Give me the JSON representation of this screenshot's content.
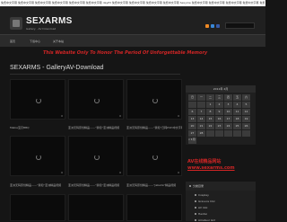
{
  "topbar": {
    "text": "免费中文字幕 免费中文字幕 免费中文字幕 免费中文字幕 免费中文字幕 免费中文字幕 dayP3 免费中文字幕 免费中文字幕 免费中文字幕 免费中文字幕 Sexyme 免费中文字幕 免费中文字幕 免费中文字幕 免费中文字幕 免费中文字幕 免费中文字幕 免费中文字幕"
  },
  "header": {
    "title": "SEXARMS",
    "subtitle": "Gallery · AV Download"
  },
  "nav": {
    "items": [
      "首页",
      "下载中心",
      "关于本站"
    ]
  },
  "marquee": "This Website Only To Honor The Period Of Unforgettable Memory",
  "section_title": "SEXARMS - GalleryAV-Download",
  "posts": [
    {
      "count": "0",
      "caption": "Mabie宝贝BBQ"
    },
    {
      "count": "0",
      "caption": "亚洲无码原创精品——“我和”亚洲精品视频"
    },
    {
      "count": "0",
      "caption": "亚洲无码原创精品——“我和”日韩DVD中文字幕精品"
    },
    {
      "count": "0",
      "caption": "亚洲无码原创精品——“我和”亚洲精品视频"
    },
    {
      "count": "0",
      "caption": "亚洲无码原创精品——“我和”亚洲精品视频"
    },
    {
      "count": "0",
      "caption": "亚洲无码原创精品——“Jabella”精品视频"
    },
    {
      "count": "",
      "caption": ""
    },
    {
      "count": "",
      "caption": ""
    },
    {
      "count": "",
      "caption": ""
    }
  ],
  "calendar": {
    "month": "2011年 2月",
    "weekdays": [
      "日",
      "一",
      "二",
      "三",
      "四",
      "五",
      "六"
    ],
    "days": [
      "",
      "",
      "1",
      "2",
      "3",
      "4",
      "5",
      "6",
      "7",
      "8",
      "9",
      "10",
      "11",
      "12",
      "13",
      "14",
      "15",
      "16",
      "17",
      "18",
      "19",
      "20",
      "21",
      "22",
      "23",
      "24",
      "25",
      "26",
      "27",
      "28",
      "",
      "",
      "",
      "",
      "",
      ""
    ],
    "prev_label": "« 1月"
  },
  "ad": {
    "title": "AV在线精品网站",
    "link": "www.sexarms.com"
  },
  "categories": {
    "title": "分类目录",
    "items": [
      "Cosplay",
      "Gravure Idol",
      "AV Idol",
      "Hentai",
      "Amateur Girl"
    ]
  },
  "colors": {
    "accent_red": "#d02525",
    "background": "#151515"
  }
}
